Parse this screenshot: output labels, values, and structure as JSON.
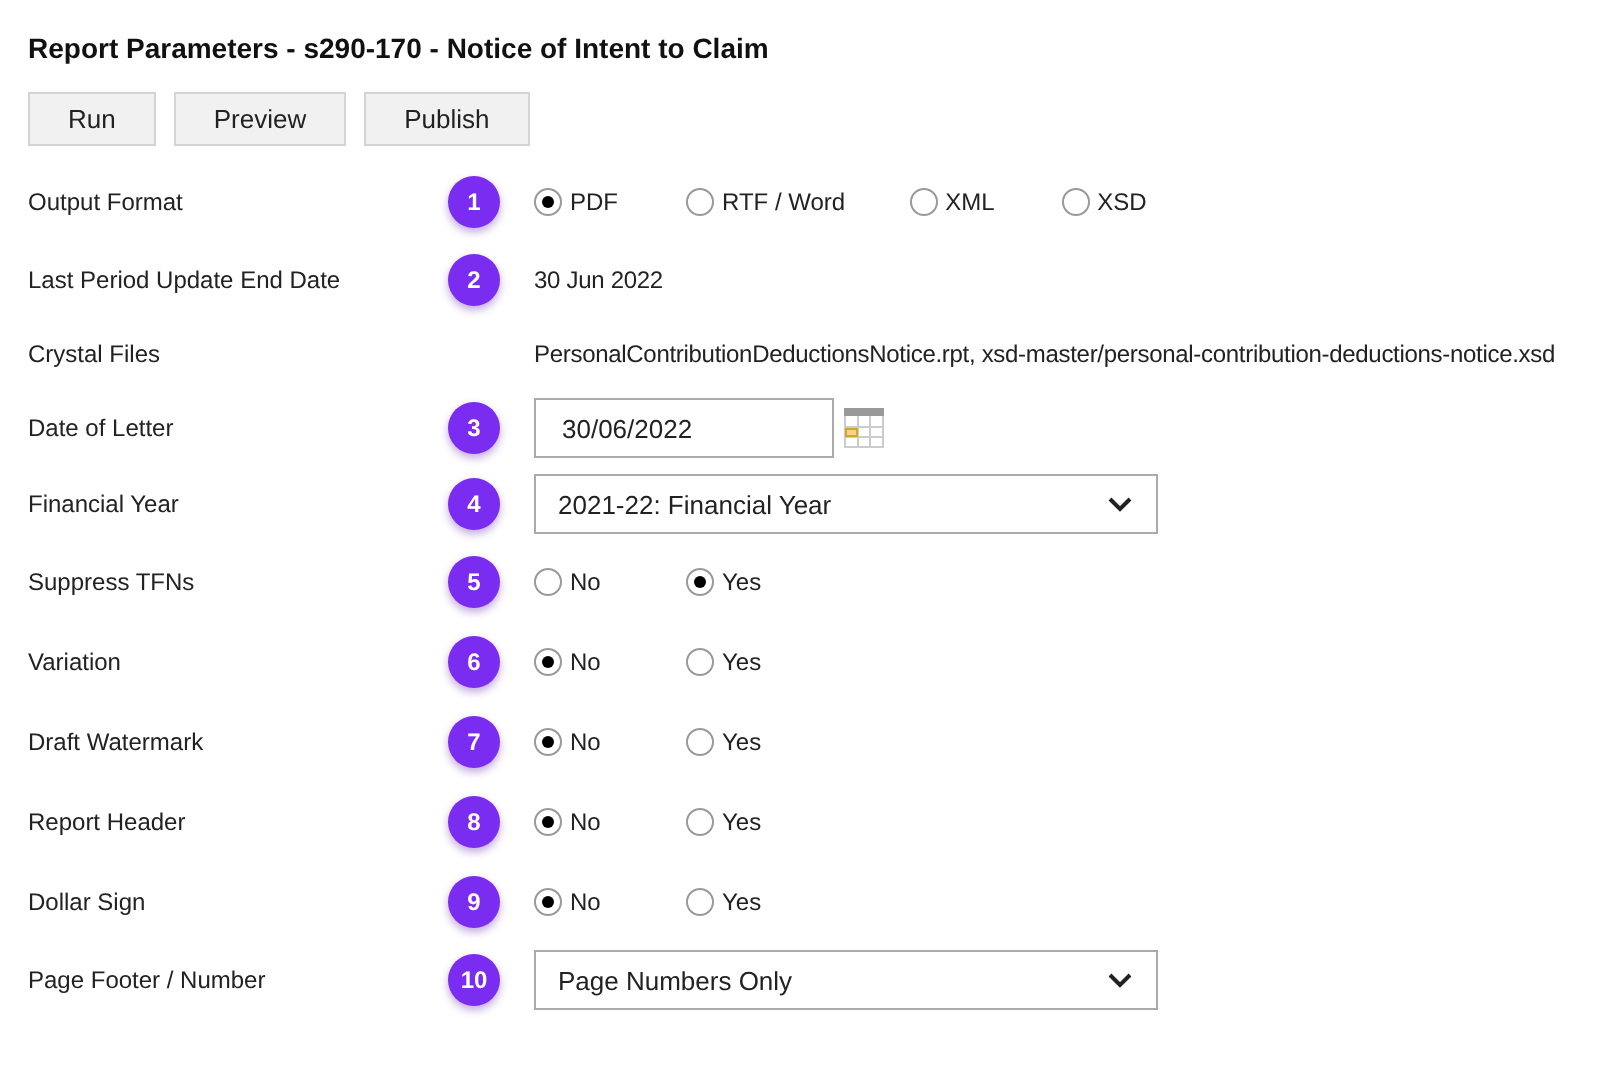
{
  "title": "Report Parameters - s290-170 - Notice of Intent to Claim",
  "buttons": [
    "Run",
    "Preview",
    "Publish"
  ],
  "fields": [
    {
      "kind": "radio",
      "label": "Output Format",
      "badge": "1",
      "options": [
        {
          "label": "PDF",
          "selected": true
        },
        {
          "label": "RTF / Word",
          "selected": false
        },
        {
          "label": "XML",
          "selected": false
        },
        {
          "label": "XSD",
          "selected": false
        }
      ]
    },
    {
      "kind": "text",
      "label": "Last Period Update End Date",
      "badge": "2",
      "value": "30 Jun 2022"
    },
    {
      "kind": "text",
      "label": "Crystal Files",
      "value": "PersonalContributionDeductionsNotice.rpt, xsd-master/personal-contribution-deductions-notice.xsd"
    },
    {
      "kind": "date",
      "label": "Date of Letter",
      "badge": "3",
      "value": "30/06/2022"
    },
    {
      "kind": "select",
      "label": "Financial Year",
      "badge": "4",
      "value": "2021-22: Financial Year"
    },
    {
      "kind": "radio",
      "label": "Suppress TFNs",
      "badge": "5",
      "options": [
        {
          "label": "No",
          "selected": false
        },
        {
          "label": "Yes",
          "selected": true
        }
      ]
    },
    {
      "kind": "radio",
      "label": "Variation",
      "badge": "6",
      "options": [
        {
          "label": "No",
          "selected": true
        },
        {
          "label": "Yes",
          "selected": false
        }
      ]
    },
    {
      "kind": "radio",
      "label": "Draft Watermark",
      "badge": "7",
      "options": [
        {
          "label": "No",
          "selected": true
        },
        {
          "label": "Yes",
          "selected": false
        }
      ]
    },
    {
      "kind": "radio",
      "label": "Report Header",
      "badge": "8",
      "options": [
        {
          "label": "No",
          "selected": true
        },
        {
          "label": "Yes",
          "selected": false
        }
      ]
    },
    {
      "kind": "radio",
      "label": "Dollar Sign",
      "badge": "9",
      "options": [
        {
          "label": "No",
          "selected": true
        },
        {
          "label": "Yes",
          "selected": false
        }
      ]
    },
    {
      "kind": "select",
      "label": "Page Footer / Number",
      "badge": "10",
      "value": "Page Numbers Only"
    }
  ]
}
